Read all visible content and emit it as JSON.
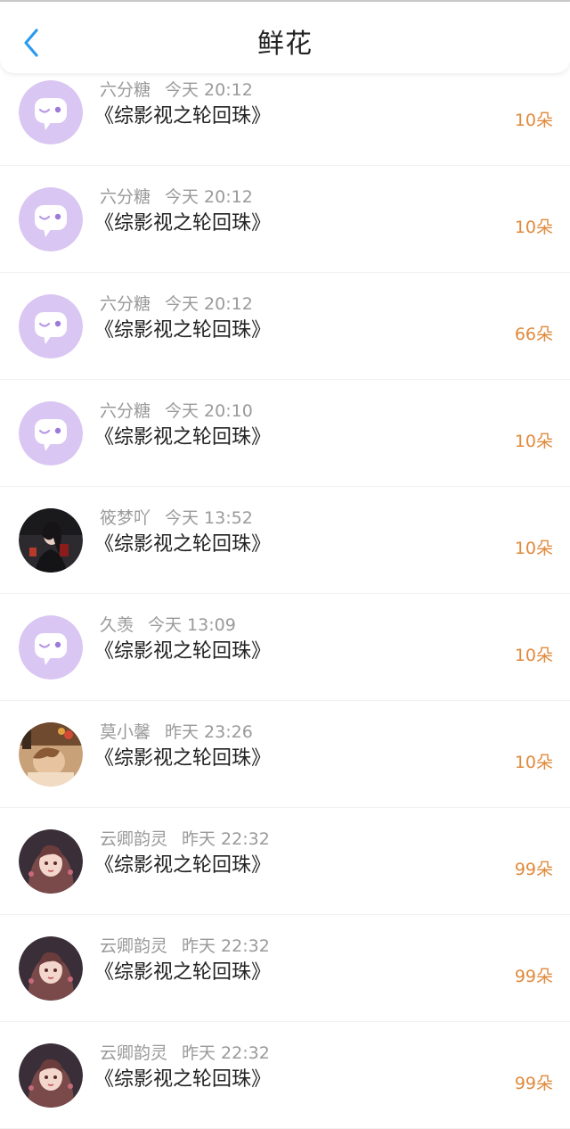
{
  "header": {
    "title": "鲜花"
  },
  "items": [
    {
      "name": "六分糖",
      "time": "今天 20:12",
      "book": "《综影视之轮回珠》",
      "flowers": "10朵",
      "avatar": "default"
    },
    {
      "name": "六分糖",
      "time": "今天 20:12",
      "book": "《综影视之轮回珠》",
      "flowers": "10朵",
      "avatar": "default"
    },
    {
      "name": "六分糖",
      "time": "今天 20:12",
      "book": "《综影视之轮回珠》",
      "flowers": "66朵",
      "avatar": "default"
    },
    {
      "name": "六分糖",
      "time": "今天 20:10",
      "book": "《综影视之轮回珠》",
      "flowers": "10朵",
      "avatar": "default"
    },
    {
      "name": "筱梦吖",
      "time": "今天 13:52",
      "book": "《综影视之轮回珠》",
      "flowers": "10朵",
      "avatar": "photo-dark"
    },
    {
      "name": "久羡",
      "time": "今天 13:09",
      "book": "《综影视之轮回珠》",
      "flowers": "10朵",
      "avatar": "default"
    },
    {
      "name": "莫小馨",
      "time": "昨天 23:26",
      "book": "《综影视之轮回珠》",
      "flowers": "10朵",
      "avatar": "photo-warm"
    },
    {
      "name": "云卿韵灵",
      "time": "昨天 22:32",
      "book": "《综影视之轮回珠》",
      "flowers": "99朵",
      "avatar": "anime-girl"
    },
    {
      "name": "云卿韵灵",
      "time": "昨天 22:32",
      "book": "《综影视之轮回珠》",
      "flowers": "99朵",
      "avatar": "anime-girl"
    },
    {
      "name": "云卿韵灵",
      "time": "昨天 22:32",
      "book": "《综影视之轮回珠》",
      "flowers": "99朵",
      "avatar": "anime-girl"
    }
  ],
  "colors": {
    "accent_back": "#2b9bf0",
    "flowers_text": "#e08a3c",
    "default_avatar_bg": "#d9c6f2"
  }
}
